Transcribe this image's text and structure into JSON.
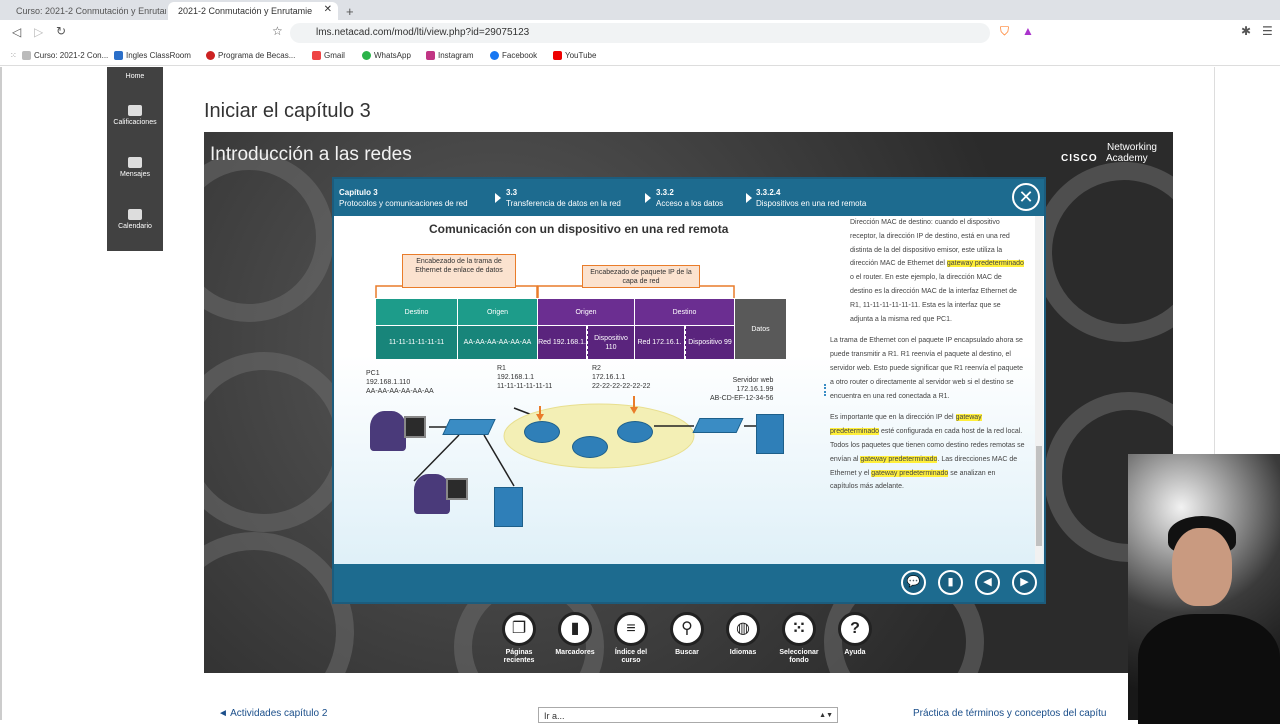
{
  "browser": {
    "tabs": [
      {
        "title": "Curso: 2021-2 Conmutación y Enrutam"
      },
      {
        "title": "2021-2 Conmutación y Enrutamie"
      }
    ],
    "url": "lms.netacad.com/mod/lti/view.php?id=29075123",
    "bookmarks": [
      {
        "label": "Curso: 2021-2 Con...",
        "color": "#bbb"
      },
      {
        "label": "Ingles ClassRoom",
        "color": "#2b6fc9"
      },
      {
        "label": "Programa de Becas...",
        "color": "#c22"
      },
      {
        "label": "Gmail",
        "color": "#e44"
      },
      {
        "label": "WhatsApp",
        "color": "#2bb34a"
      },
      {
        "label": "Instagram",
        "color": "#c13584"
      },
      {
        "label": "Facebook",
        "color": "#1877f2"
      },
      {
        "label": "YouTube",
        "color": "#e00"
      }
    ]
  },
  "sidenav": {
    "home": "Home",
    "items": [
      {
        "label": "Calificaciones",
        "icon": "grades-icon"
      },
      {
        "label": "Mensajes",
        "icon": "messages-icon"
      },
      {
        "label": "Calendario",
        "icon": "calendar-icon"
      }
    ]
  },
  "page_title": "Iniciar el capítulo 3",
  "stage": {
    "title": "Introducción a las redes",
    "brand_line1": "Networking",
    "brand_line2": "Academy",
    "brand_cisco": "CISCO"
  },
  "modal": {
    "breadcrumbs": [
      {
        "top": "Capítulo 3",
        "bottom": "Protocolos y comunicaciones de red"
      },
      {
        "top": "3.3",
        "bottom": "Transferencia de datos en la red"
      },
      {
        "top": "3.3.2",
        "bottom": "Acceso a los datos"
      },
      {
        "top": "3.3.2.4",
        "bottom": "Dispositivos en una red remota"
      }
    ],
    "diagram": {
      "title": "Comunicación con un dispositivo en una red remota",
      "eth_header": "Encabezado de la trama de Ethernet de enlace de datos",
      "ip_header": "Encabezado de paquete IP de la capa de red",
      "cols": {
        "destino": "Destino",
        "origen": "Origen",
        "ip_origen": "Origen",
        "ip_destino": "Destino",
        "datos": "Datos"
      },
      "values": {
        "mac_dst": "11-11-11-11-11-11",
        "mac_src": "AA-AA-AA-AA-AA-AA",
        "src_red": "Red 192.168.1.",
        "src_disp": "Dispositivo 110",
        "dst_red": "Red 172.16.1.",
        "dst_disp": "Dispositivo 99"
      },
      "devices": {
        "pc1": [
          "PC1",
          "192.168.1.110",
          "AA-AA-AA-AA-AA-AA"
        ],
        "r1": [
          "R1",
          "192.168.1.1",
          "11-11-11-11-11-11"
        ],
        "r2": [
          "R2",
          "172.16.1.1",
          "22-22-22-22-22-22"
        ],
        "web": [
          "Servidor web",
          "172.16.1.99",
          "AB-CD-EF-12-34-56"
        ]
      }
    },
    "text": {
      "p1": "Dirección MAC de destino: cuando el dispositivo receptor, la dirección IP de destino, está en una red distinta de la del dispositivo emisor, este utiliza la dirección MAC de Ethernet del",
      "p1_hl": "gateway predeterminado",
      "p1_end": "o el router. En este ejemplo, la dirección MAC de destino es la dirección MAC de la interfaz Ethernet de R1, 11-11-11-11-11-11. Esta es la interfaz que se adjunta a la misma red que PC1.",
      "p2": "La trama de Ethernet con el paquete IP encapsulado ahora se puede transmitir a R1. R1 reenvía el paquete al destino, el servidor web. Esto puede significar que R1 reenvía el paquete a otro router o directamente al servidor web si el destino se encuentra en una red conectada a R1.",
      "p3a": "Es importante que en la dirección IP del",
      "p3_hl1": "gateway predeterminado",
      "p3b": "esté configurada en cada host de la red local. Todos los paquetes que tienen como destino redes remotas se envían al",
      "p3_hl2": "gateway predeterminado",
      "p3c": ". Las direcciones MAC de Ethernet y el",
      "p3_hl3": "gateway predeterminado",
      "p3d": "se analizan en capítulos más adelante."
    }
  },
  "toolbar": [
    {
      "label": "Páginas recientes",
      "icon": "recent-pages-icon",
      "glyph": "❐"
    },
    {
      "label": "Marcadores",
      "icon": "bookmark-icon",
      "glyph": "▮"
    },
    {
      "label": "Índice del curso",
      "icon": "menu-icon",
      "glyph": "≡"
    },
    {
      "label": "Buscar",
      "icon": "search-icon",
      "glyph": "⚲"
    },
    {
      "label": "Idiomas",
      "icon": "globe-icon",
      "glyph": "◍"
    },
    {
      "label": "Seleccionar fondo",
      "icon": "grid-icon",
      "glyph": "⁙"
    },
    {
      "label": "Ayuda",
      "icon": "help-icon",
      "glyph": "?"
    }
  ],
  "bottom_nav": {
    "prev": "◄ Actividades capítulo 2",
    "select": "Ir a...",
    "next": "Práctica de términos y conceptos del capítu"
  }
}
